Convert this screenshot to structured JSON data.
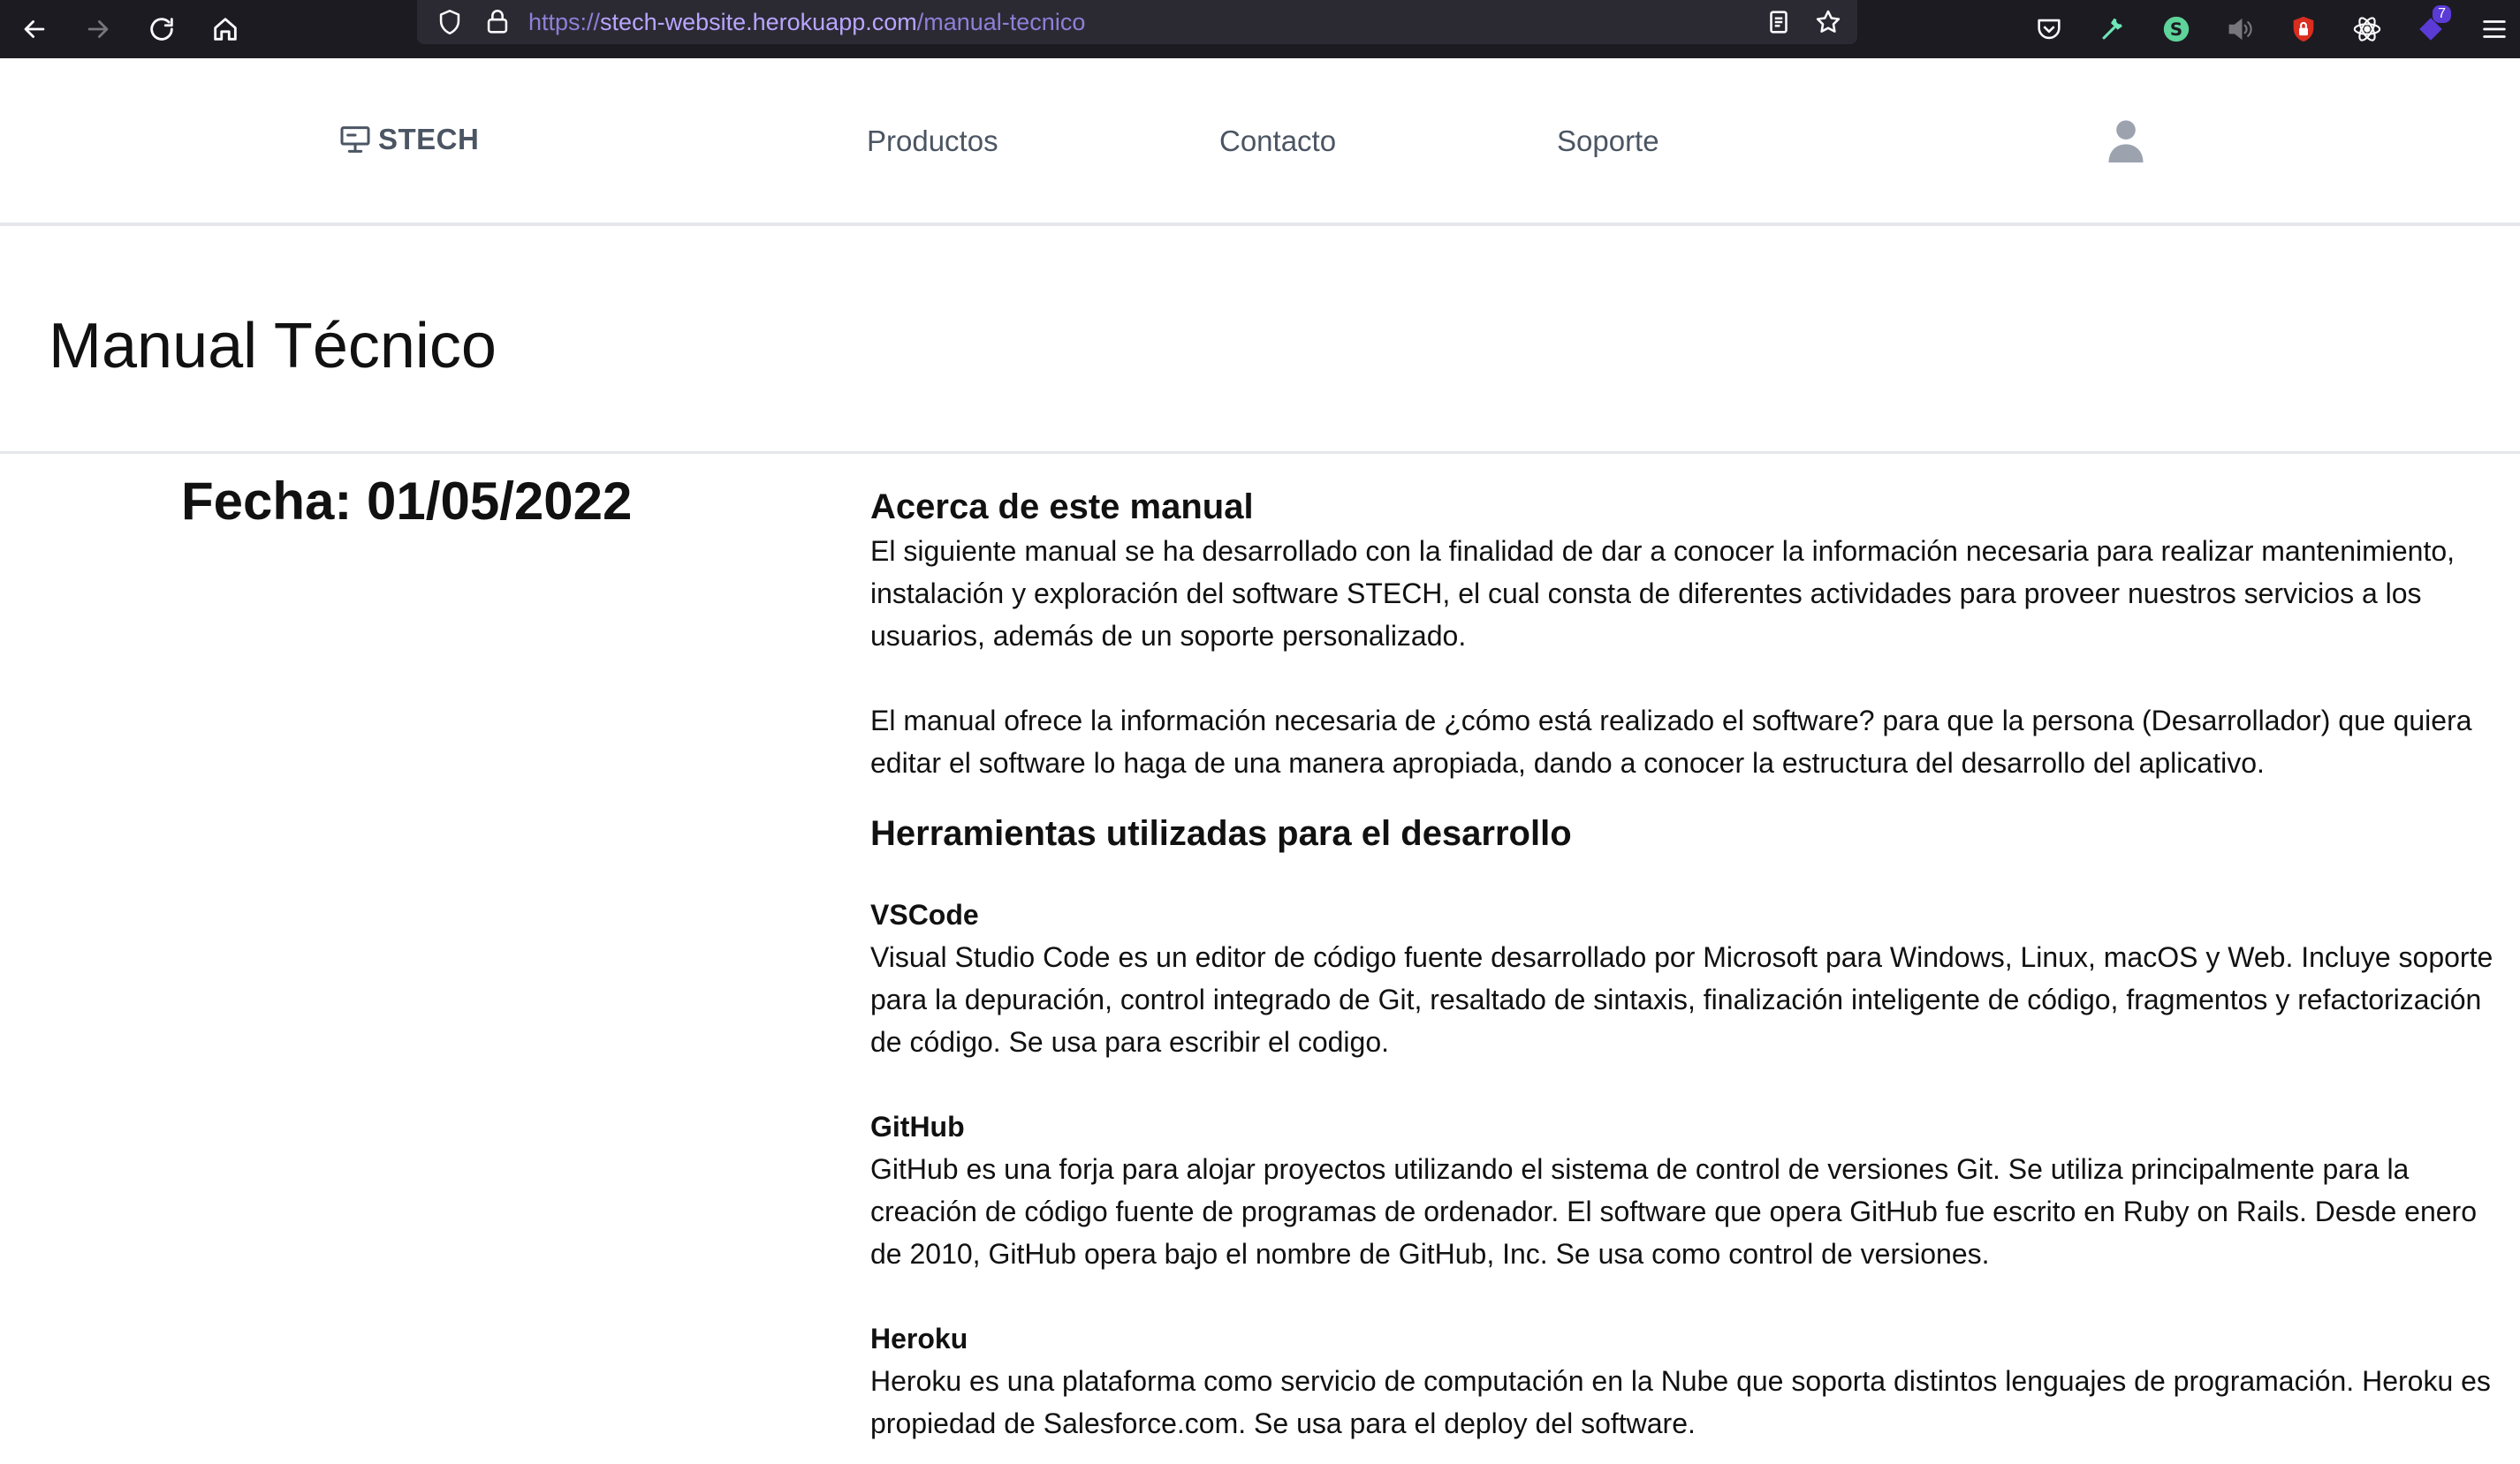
{
  "browser": {
    "url_scheme": "https://",
    "url_host": "stech-website.herokuapp.com",
    "url_path": "/manual-tecnico",
    "extension_badge": "7"
  },
  "header": {
    "logo_text": "STECH",
    "nav": [
      "Productos",
      "Contacto",
      "Soporte"
    ]
  },
  "page": {
    "title": "Manual Técnico",
    "date": "Fecha: 01/05/2022"
  },
  "content": {
    "about_heading": "Acerca de este manual",
    "about_p1": "El siguiente manual se ha desarrollado con la finalidad de dar a conocer la información necesaria para realizar mantenimiento, instalación y exploración del software STECH, el cual consta de diferentes actividades para proveer nuestros servicios a los usuarios, además de un soporte personalizado.",
    "about_p2": "El manual ofrece la información necesaria de ¿cómo está realizado el software? para que la persona (Desarrollador) que quiera editar el software lo haga de una manera apropiada, dando a conocer la estructura del desarrollo del aplicativo.",
    "tools_heading": "Herramientas utilizadas para el desarrollo",
    "tools": [
      {
        "name": "VSCode",
        "desc": "Visual Studio Code es un editor de código fuente desarrollado por Microsoft para Windows, Linux, macOS y Web. Incluye soporte para la depuración, control integrado de Git, resaltado de sintaxis, finalización inteligente de código, fragmentos y refactorización de código. Se usa para escribir el codigo."
      },
      {
        "name": "GitHub",
        "desc": "GitHub es una forja para alojar proyectos utilizando el sistema de control de versiones Git. Se utiliza principalmente para la creación de código fuente de programas de ordenador. El software que opera GitHub fue escrito en Ruby on Rails. Desde enero de 2010, GitHub opera bajo el nombre de GitHub, Inc. Se usa como control de versiones."
      },
      {
        "name": "Heroku",
        "desc": "Heroku es una plataforma como servicio de computación en la Nube que soporta distintos lenguajes de programación. Heroku es propiedad de Salesforce.com. Se usa para el deploy del software."
      }
    ]
  }
}
